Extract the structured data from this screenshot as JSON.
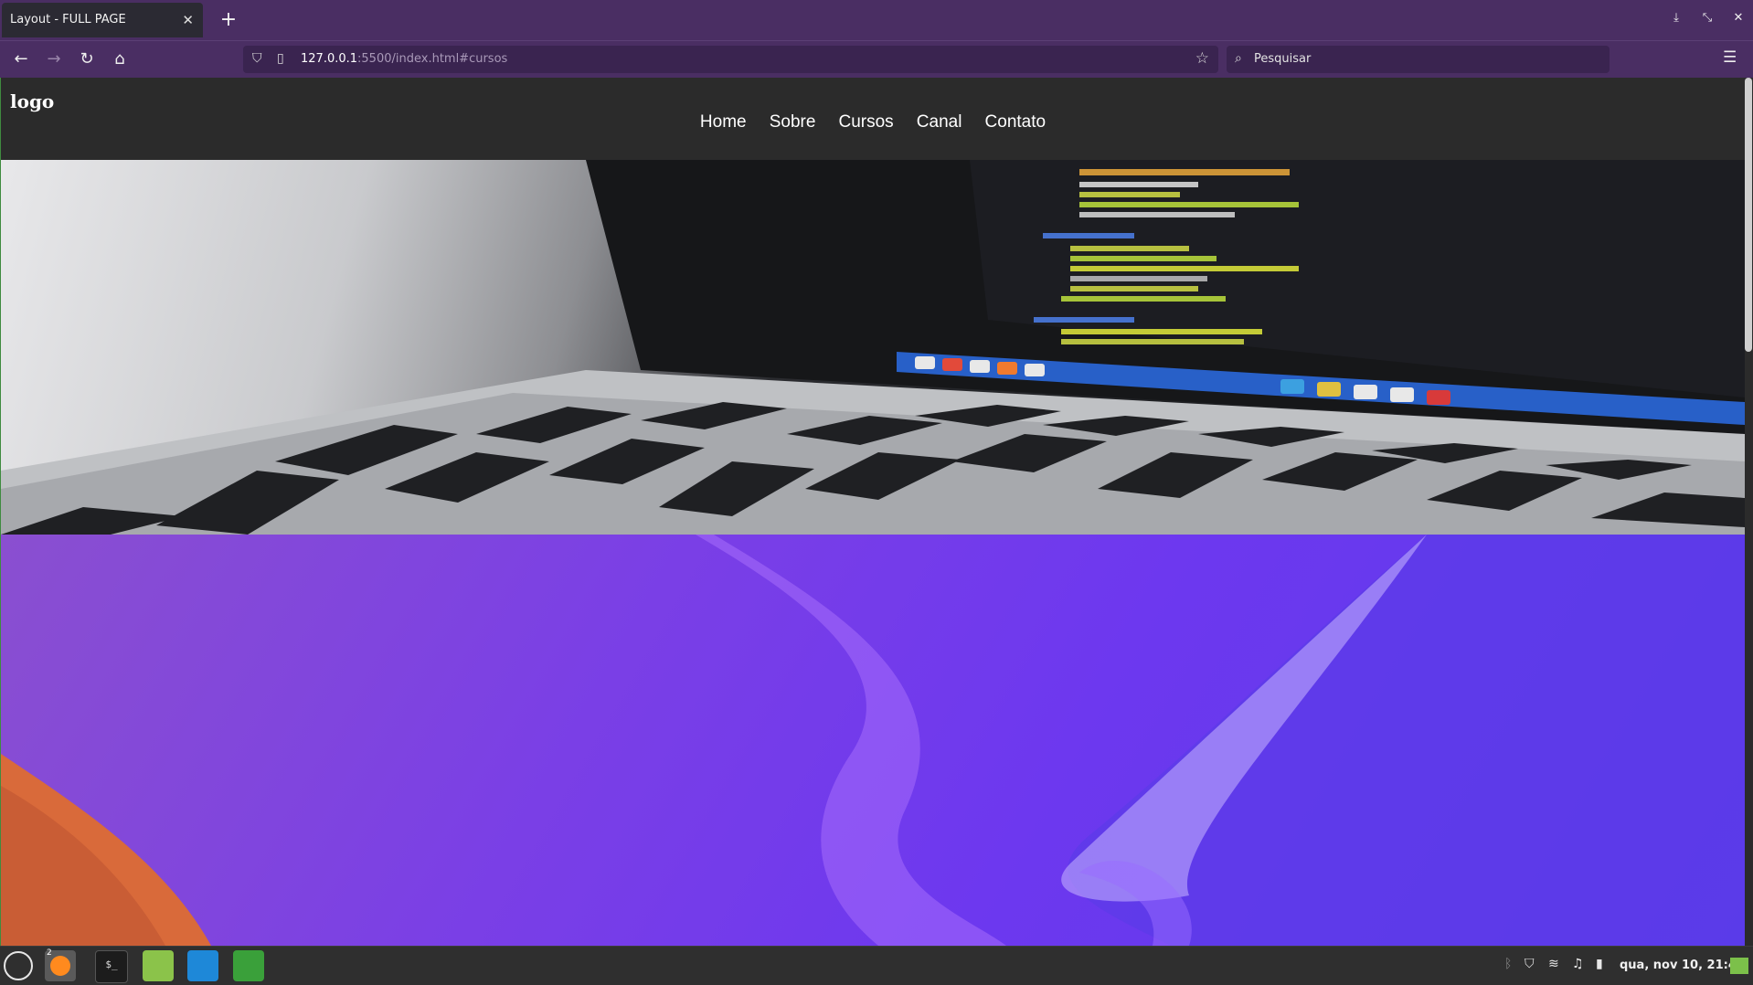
{
  "browser": {
    "tab_title": "Layout - FULL PAGE",
    "tab_close": "✕",
    "new_tab": "+",
    "url_host": "127.0.0.1",
    "url_rest": ":5500/index.html#cursos",
    "search_placeholder": "Pesquisar",
    "menu_icon": "☰"
  },
  "site": {
    "logo": "logo",
    "nav": [
      "Home",
      "Sobre",
      "Cursos",
      "Canal",
      "Contato"
    ]
  },
  "taskbar": {
    "firefox_badge": "2",
    "clock": "qua, nov 10, 21:44"
  },
  "colors": {
    "chrome": "#4a2e63",
    "url_bg": "#3a2450",
    "site_bg": "#2b2b2b",
    "wallpaper_accent": "#7a3fe6"
  }
}
